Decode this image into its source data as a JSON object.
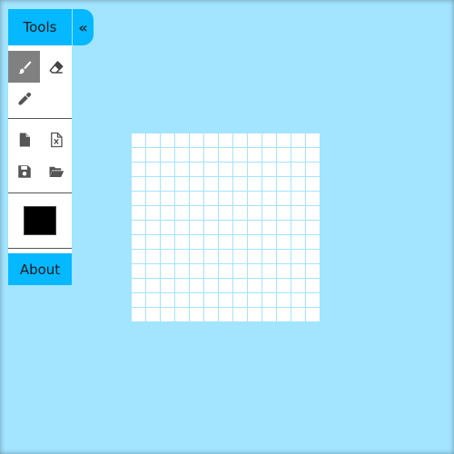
{
  "panel": {
    "title": "Tools",
    "collapse_icon": "double-chevron-left-icon",
    "tools": [
      {
        "name": "brush",
        "icon": "brush-icon",
        "active": true
      },
      {
        "name": "eraser",
        "icon": "eraser-icon",
        "active": false
      },
      {
        "name": "eyedropper",
        "icon": "eyedropper-icon",
        "active": false
      }
    ],
    "file_actions": [
      {
        "name": "new",
        "icon": "new-file-icon"
      },
      {
        "name": "export",
        "icon": "export-file-icon"
      },
      {
        "name": "save",
        "icon": "save-icon"
      },
      {
        "name": "open",
        "icon": "open-folder-icon"
      }
    ],
    "current_color": "#000000",
    "about_label": "About"
  },
  "canvas": {
    "grid_columns": 13,
    "grid_rows": 13,
    "cell_color": "#ffffff",
    "grid_line_color": "#a3e4ff"
  },
  "colors": {
    "background": "#a3e4ff",
    "accent": "#05b8ff",
    "active_tool": "#808080"
  }
}
